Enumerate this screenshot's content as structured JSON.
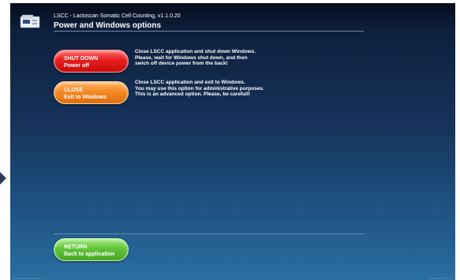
{
  "header": {
    "app_title": "LSCC - Lactoscan Somatic Cell Counting, v1.1.0.20",
    "page_title": "Power and Windows options",
    "icon": "analyzer-device-icon"
  },
  "options": {
    "shutdown": {
      "label_line1": "SHUT DOWN",
      "label_line2": "Power off",
      "color": "#e61e1e",
      "description": [
        "Close LSCC application and shut down Windows.",
        "Please, wait for Windows shut down, and then",
        "swich off device power from the back!"
      ]
    },
    "exit": {
      "label_line1": "CLOSE",
      "label_line2": "Exit to Windows",
      "color": "#f48a24",
      "description": [
        "Close LSCC application and exit to Windows.",
        "You may use this option for administrative purposes.",
        "This is an advanced option. Please, be carefull!"
      ]
    },
    "return": {
      "label_line1": "RETURN",
      "label_line2": "Back to application",
      "color": "#62c43a"
    }
  },
  "footer": {
    "left": "www.Lactoscan.com",
    "right": "Version v1.1.0.20"
  }
}
